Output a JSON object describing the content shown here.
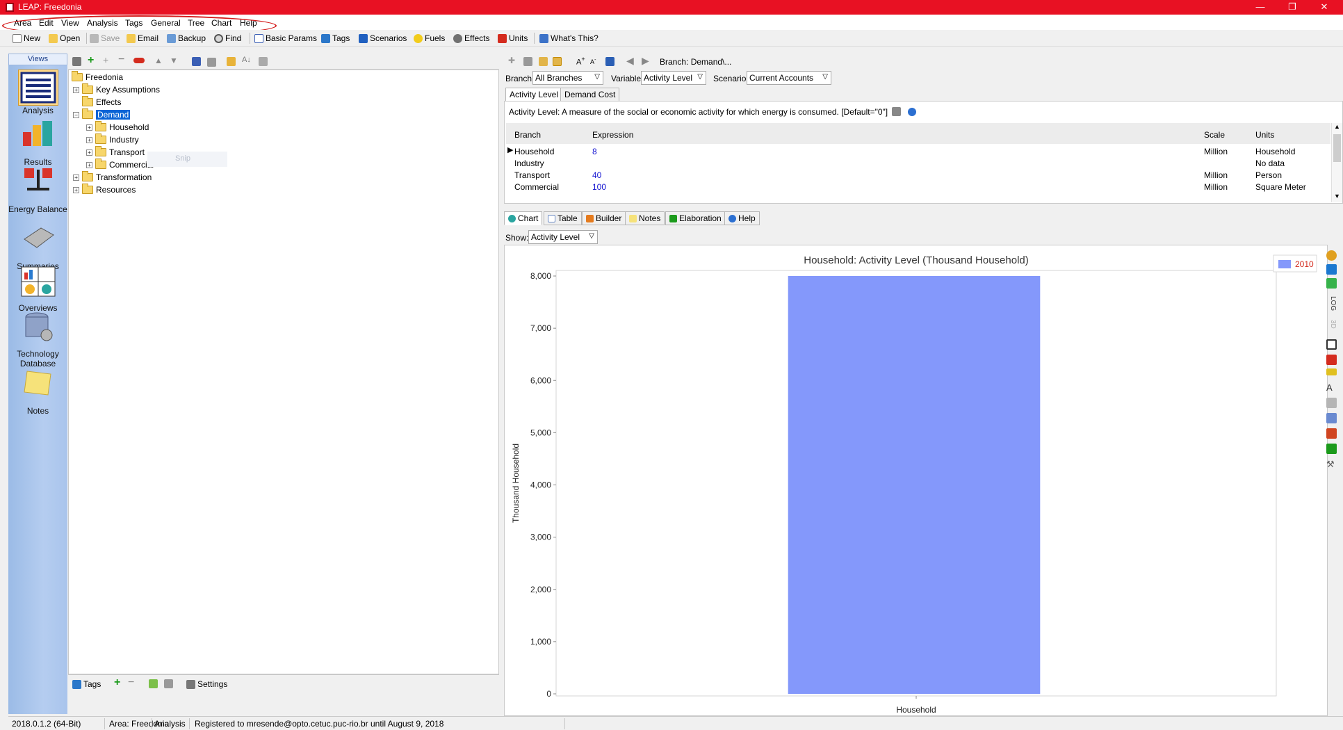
{
  "window": {
    "title": "LEAP: Freedonia",
    "titlebar_color": "#e81123"
  },
  "menu": [
    "Area",
    "Edit",
    "View",
    "Analysis",
    "Tags",
    "General",
    "Tree",
    "Chart",
    "Help"
  ],
  "toolbar": {
    "new": "New",
    "open": "Open",
    "save": "Save",
    "email": "Email",
    "backup": "Backup",
    "find": "Find",
    "basic_params": "Basic Params",
    "tags": "Tags",
    "scenarios": "Scenarios",
    "fuels": "Fuels",
    "effects": "Effects",
    "units": "Units",
    "whats_this": "What's This?"
  },
  "views": {
    "header": "Views",
    "items": [
      "Analysis",
      "Results",
      "Energy Balance",
      "Summaries",
      "Overviews",
      "Technology Database",
      "Notes"
    ],
    "active": "Analysis"
  },
  "tree": {
    "root": "Freedonia",
    "items": [
      "Key Assumptions",
      "Effects",
      "Demand",
      "Household",
      "Industry",
      "Transport",
      "Commercial",
      "Transformation",
      "Resources"
    ],
    "selected": "Demand",
    "drag_ghost": "Snip"
  },
  "tags_bar": {
    "tags": "Tags",
    "settings": "Settings"
  },
  "right_toolbar": {
    "branch_path": "Branch: Demand\\..."
  },
  "selectors": {
    "branch_label": "Branch:",
    "branch_value": "All Branches",
    "variable_label": "Variable:",
    "variable_value": "Activity Level",
    "scenario_label": "Scenario:",
    "scenario_value": "Current Accounts"
  },
  "top_tabs": [
    "Activity Level",
    "Demand Cost"
  ],
  "description": "Activity Level: A measure of the social or economic activity for which energy is consumed. [Default=\"0\"]",
  "grid": {
    "headers": [
      "Branch",
      "Expression",
      "Scale",
      "Units"
    ],
    "rows": [
      {
        "branch": "Household",
        "expression": "8",
        "scale": "Million",
        "units": "Household"
      },
      {
        "branch": "Industry",
        "expression": "",
        "scale": "",
        "units": "No data"
      },
      {
        "branch": "Transport",
        "expression": "40",
        "scale": "Million",
        "units": "Person"
      },
      {
        "branch": "Commercial",
        "expression": "100",
        "scale": "Million",
        "units": "Square Meter"
      }
    ]
  },
  "bottom_tabs": [
    "Chart",
    "Table",
    "Builder",
    "Notes",
    "Elaboration",
    "Help"
  ],
  "show": {
    "label": "Show:",
    "value": "Activity Level"
  },
  "chart_side_icons": {
    "log": "LOG",
    "three_d": "3D"
  },
  "chart_data": {
    "type": "bar",
    "title": "Household: Activity Level (Thousand Household)",
    "categories": [
      "Household"
    ],
    "series": [
      {
        "name": "2010",
        "values": [
          8000
        ],
        "color": "#8498fb"
      }
    ],
    "ylabel": "Thousand Household",
    "xlabel": "",
    "ylim": [
      0,
      8000
    ],
    "yticks": [
      0,
      1000,
      2000,
      3000,
      4000,
      5000,
      6000,
      7000,
      8000
    ],
    "ytick_labels": [
      "0",
      "1,000",
      "2,000",
      "3,000",
      "4,000",
      "5,000",
      "6,000",
      "7,000",
      "8,000"
    ],
    "legend": "top-right",
    "grid": false
  },
  "status": {
    "version": "2018.0.1.2 (64-Bit)",
    "area": "Area: Freedonia",
    "view": "Analysis",
    "registration": "Registered to mresende@opto.cetuc.puc-rio.br until August 9, 2018"
  }
}
